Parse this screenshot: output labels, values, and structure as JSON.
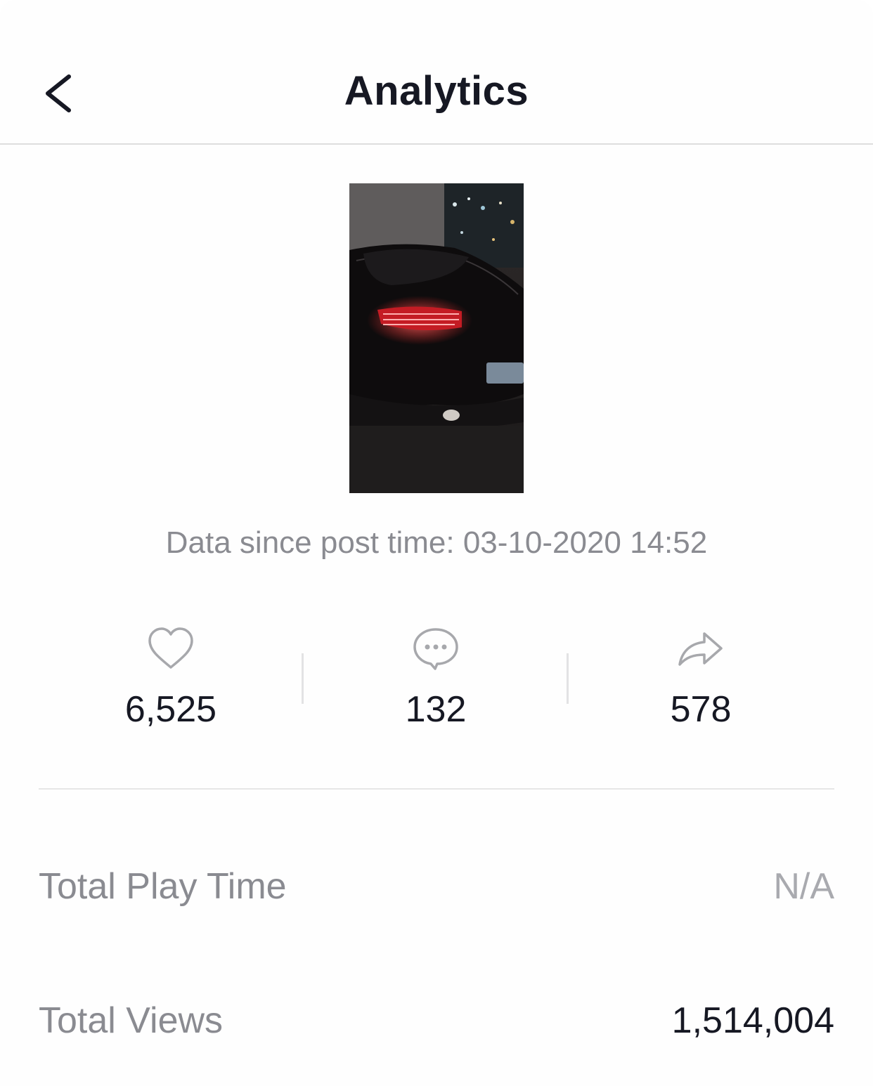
{
  "header": {
    "title": "Analytics",
    "back_icon": "chevron-left-icon"
  },
  "video": {
    "thumbnail": "night street scene: rear view of a black car with red tail lights",
    "post_time_text": "Data since post time: 03-10-2020 14:52"
  },
  "stats": {
    "likes": {
      "icon": "heart-icon",
      "value": "6,525"
    },
    "comments": {
      "icon": "comment-icon",
      "value": "132"
    },
    "shares": {
      "icon": "share-icon",
      "value": "578"
    }
  },
  "metrics": {
    "total_play_time": {
      "label": "Total Play Time",
      "value": "N/A"
    },
    "total_views": {
      "label": "Total Views",
      "value": "1,514,004"
    }
  },
  "colors": {
    "title_text": "#161823",
    "secondary_text": "#8a8b91",
    "muted_value": "#a9aaaf",
    "divider": "#e6e6e7",
    "icon_stroke": "#a7a8ac"
  }
}
